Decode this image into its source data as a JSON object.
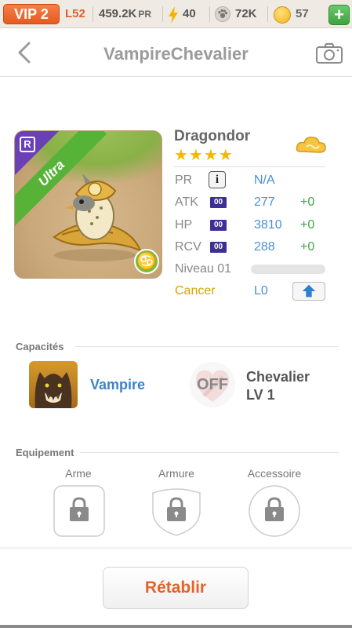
{
  "status": {
    "vip": "VIP 2",
    "level": "L52",
    "pr_value": "459.2K",
    "pr_unit": "PR",
    "energy": "40",
    "pets": "72K",
    "coins": "57",
    "add": "+"
  },
  "header": {
    "title": "VampireChevalier"
  },
  "monster": {
    "name": "Dragondor",
    "stars": "★★★★",
    "rarity": "Ultra",
    "rank_badge": "R",
    "zodiac_glyph": "♋",
    "stats": {
      "pr_label": "PR",
      "pr_info": "i",
      "pr_value": "N/A",
      "atk_label": "ATK",
      "atk_tag": "00",
      "atk_value": "277",
      "atk_bonus": "+0",
      "hp_label": "HP",
      "hp_tag": "00",
      "hp_value": "3810",
      "hp_bonus": "+0",
      "rcv_label": "RCV",
      "rcv_tag": "00",
      "rcv_value": "288",
      "rcv_bonus": "+0",
      "level_label": "Niveau 01",
      "level_progress": 0.0
    },
    "sign": "Cancer",
    "sign_level": "L0"
  },
  "abilities": {
    "section_title": "Capacités",
    "ability1": "Vampire",
    "ability2_state": "OFF",
    "ability2_name": "Chevalier",
    "ability2_level": "LV 1"
  },
  "equipment": {
    "section_title": "Equipement",
    "slots": [
      "Arme",
      "Armure",
      "Accessoire"
    ]
  },
  "actions": {
    "reset": "Rétablir"
  },
  "colors": {
    "accent_orange": "#e2642c",
    "stat_blue": "#4a8fd2",
    "bonus_green": "#3fa64a",
    "ultra_green": "#57b338",
    "rank_purple": "#6a3fb8"
  }
}
